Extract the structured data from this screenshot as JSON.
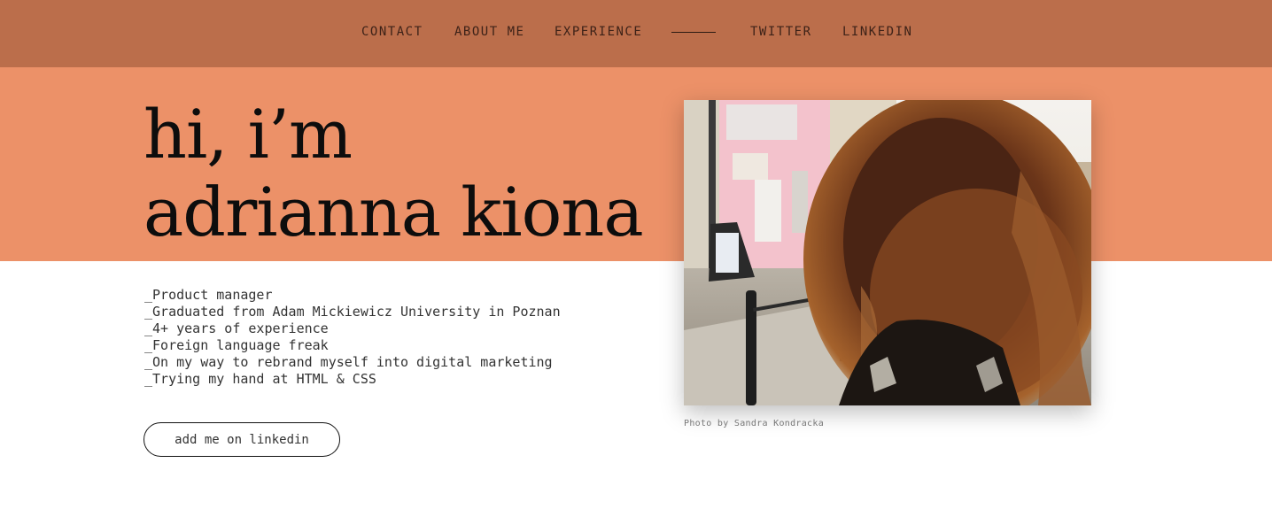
{
  "nav": {
    "items": [
      "CONTACT",
      "ABOUT ME",
      "EXPERIENCE",
      "TWITTER",
      "LINKEDIN"
    ]
  },
  "hero": {
    "title_line1": "hi, i’m",
    "title_line2": "adrianna kiona"
  },
  "bio": [
    "_Product manager",
    "_Graduated from Adam Mickiewicz University in Poznan",
    "_4+ years of experience",
    "_Foreign language freak",
    "_On my way to rebrand myself into digital marketing",
    "_Trying my hand at HTML & CSS"
  ],
  "cta": {
    "label": "add me on linkedin"
  },
  "photo": {
    "caption": "Photo by Sandra Kondracka"
  },
  "colors": {
    "nav_bg": "#bb6e4b",
    "hero_bg": "#ec9168",
    "text": "#0d0d0d"
  }
}
